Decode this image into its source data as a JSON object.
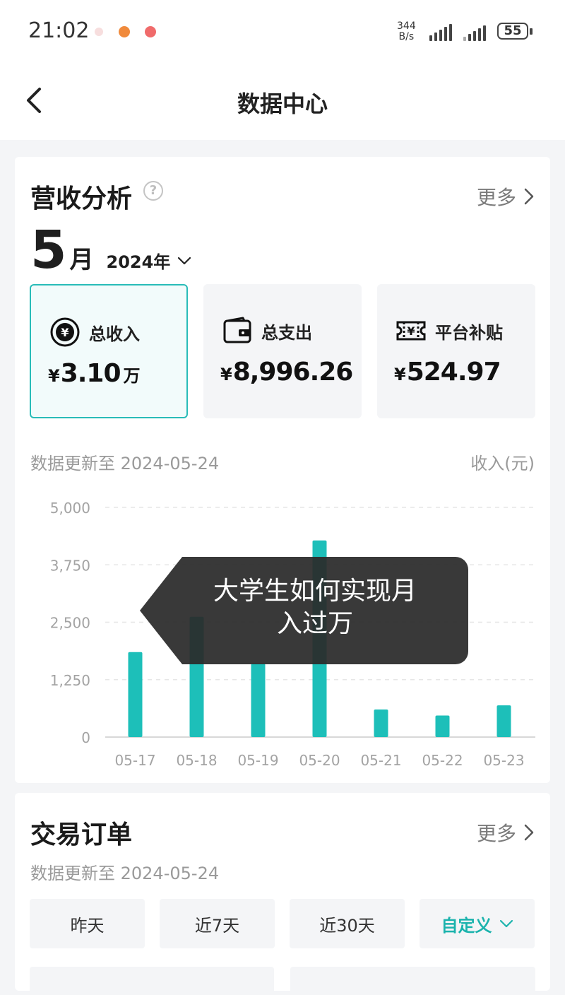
{
  "status_bar": {
    "time": "21:02",
    "net_speed_value": "344",
    "net_speed_unit": "B/s",
    "battery": "55"
  },
  "header": {
    "title": "数据中心",
    "back_icon": "chevron-left-icon"
  },
  "revenue": {
    "title": "营收分析",
    "help_icon": "question-circle-icon",
    "more_label": "更多",
    "month": "5",
    "month_unit": "月",
    "year": "2024年",
    "stats": [
      {
        "label": "总收入",
        "currency": "¥",
        "value": "3.10",
        "unit": "万",
        "icon": "yuan-coin-icon",
        "active": true
      },
      {
        "label": "总支出",
        "currency": "¥",
        "value": "8,996.26",
        "unit": "",
        "icon": "wallet-icon",
        "active": false
      },
      {
        "label": "平台补贴",
        "currency": "¥",
        "value": "524.97",
        "unit": "",
        "icon": "yuan-ticket-icon",
        "active": false
      }
    ],
    "update_note": "数据更新至 2024-05-24",
    "unit_note": "收入(元)"
  },
  "chart_data": {
    "type": "bar",
    "categories": [
      "05-17",
      "05-18",
      "05-19",
      "05-20",
      "05-21",
      "05-22",
      "05-23"
    ],
    "values": [
      1850,
      2620,
      1600,
      4280,
      600,
      470,
      690
    ],
    "ylim": [
      0,
      5000
    ],
    "yticks": [
      "0",
      "1,250",
      "2,500",
      "3,750",
      "5,000"
    ],
    "ytick_values": [
      0,
      1250,
      2500,
      3750,
      5000
    ],
    "grid": true,
    "colors": {
      "bar": "#1dbfb9"
    }
  },
  "overlay": {
    "text_line1": "大学生如何实现月",
    "text_line2": "入过万"
  },
  "orders": {
    "title": "交易订单",
    "more_label": "更多",
    "update_note": "数据更新至 2024-05-24",
    "filters": [
      {
        "label": "昨天"
      },
      {
        "label": "近7天"
      },
      {
        "label": "近30天"
      },
      {
        "label": "自定义",
        "dropdown": true
      }
    ]
  },
  "colors": {
    "accent": "#1dbfb9",
    "page_bg": "#f4f5f7"
  }
}
